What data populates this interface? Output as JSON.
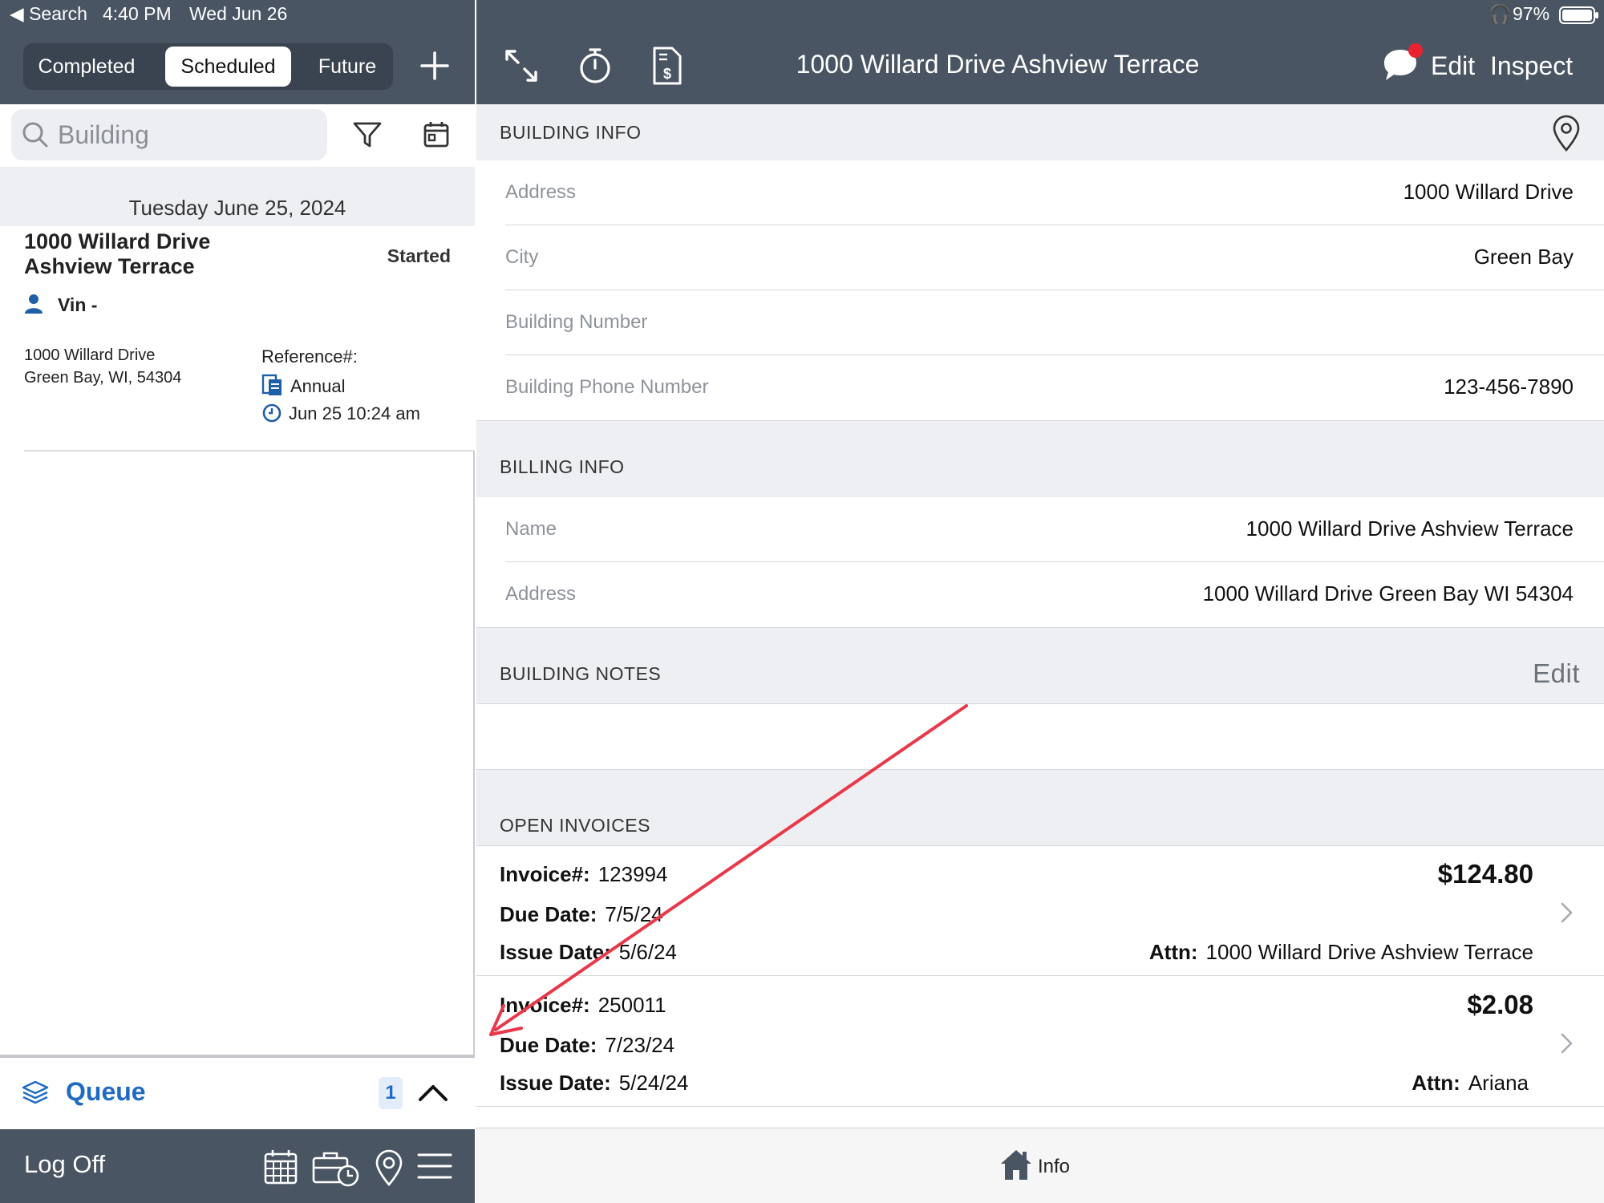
{
  "status_bar": {
    "back_app": "◀ Search",
    "time": "4:40 PM",
    "date": "Wed Jun 26",
    "battery_pct": "97%"
  },
  "segments": [
    "Completed",
    "Scheduled",
    "Future"
  ],
  "active_segment": "Scheduled",
  "search": {
    "placeholder": "Building",
    "value": ""
  },
  "appointments": {
    "date_header": "Tuesday June 25, 2024",
    "item": {
      "title": "1000 Willard Drive Ashview Terrace",
      "status": "Started",
      "user": "Vin -",
      "address_line1": "1000 Willard Drive",
      "address_line2": "Green Bay, WI, 54304",
      "reference_label": "Reference#:",
      "type": "Annual",
      "time": "Jun 25 10:24 am"
    }
  },
  "queue": {
    "label": "Queue",
    "count": "1"
  },
  "left_bottom": {
    "logoff_label": "Log Off"
  },
  "header": {
    "title": "1000 Willard Drive Ashview Terrace",
    "edit_label": "Edit",
    "inspect_label": "Inspect"
  },
  "building_info": {
    "header": "BUILDING INFO",
    "fields": [
      {
        "label": "Address",
        "value": "1000 Willard Drive"
      },
      {
        "label": "City",
        "value": "Green Bay"
      },
      {
        "label": "Building Number",
        "value": ""
      },
      {
        "label": "Building Phone Number",
        "value": "123-456-7890"
      }
    ]
  },
  "billing_info": {
    "header": "BILLING INFO",
    "fields": [
      {
        "label": "Name",
        "value": "1000 Willard Drive Ashview Terrace"
      },
      {
        "label": "Address",
        "value": "1000 Willard Drive Green Bay WI 54304"
      }
    ]
  },
  "building_notes": {
    "header": "BUILDING NOTES",
    "edit_label": "Edit",
    "text": ""
  },
  "open_invoices": {
    "header": "OPEN INVOICES",
    "invoice_label": "Invoice#:",
    "due_label": "Due Date:",
    "issue_label": "Issue Date:",
    "attn_label": "Attn:",
    "items": [
      {
        "number": "123994",
        "due": "7/5/24",
        "issue": "5/6/24",
        "amount": "$124.80",
        "attn": "1000 Willard Drive Ashview Terrace"
      },
      {
        "number": "250011",
        "due": "7/23/24",
        "issue": "5/24/24",
        "amount": "$2.08",
        "attn": "Ariana"
      }
    ]
  },
  "tabbar": {
    "info_label": "Info"
  },
  "colors": {
    "nav_bg": "#4a5563",
    "accent_blue": "#1f6bc4",
    "section_bg": "#eeeff3",
    "notification_red": "#e8232f",
    "annotation_arrow": "#e8394a"
  }
}
